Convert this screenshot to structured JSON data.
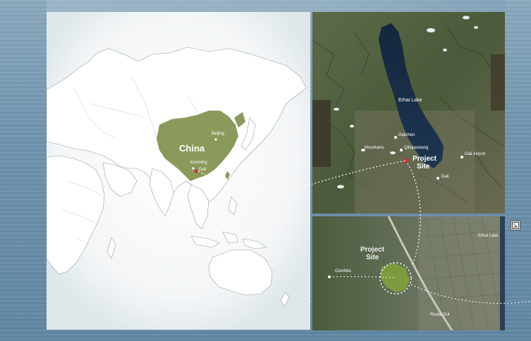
{
  "world_map": {
    "country_label": "China",
    "cities": [
      {
        "name": "Beijing"
      },
      {
        "name": "Kunming"
      },
      {
        "name": "Dali"
      }
    ]
  },
  "regional_map": {
    "labels": {
      "lake": "Erhai Lake",
      "dalizhen": "Dalizhen",
      "qiliqiaoxiang": "Qiliqiaoxiang",
      "mountains": "Mountains",
      "airport": "Dali Airport",
      "dali": "Dali",
      "project_site_line1": "Project",
      "project_site_line2": "Site"
    }
  },
  "site_map": {
    "labels": {
      "project_site_line1": "Project",
      "project_site_line2": "Site",
      "gondola": "Gondola",
      "lake": "Erhai Lake",
      "route": "Route 214"
    }
  },
  "colors": {
    "china_fill": "#8a9a5b",
    "marker": "#d0312d",
    "site_fill": "#7fa03c"
  },
  "icons": {
    "expand": "image-expand-icon"
  }
}
